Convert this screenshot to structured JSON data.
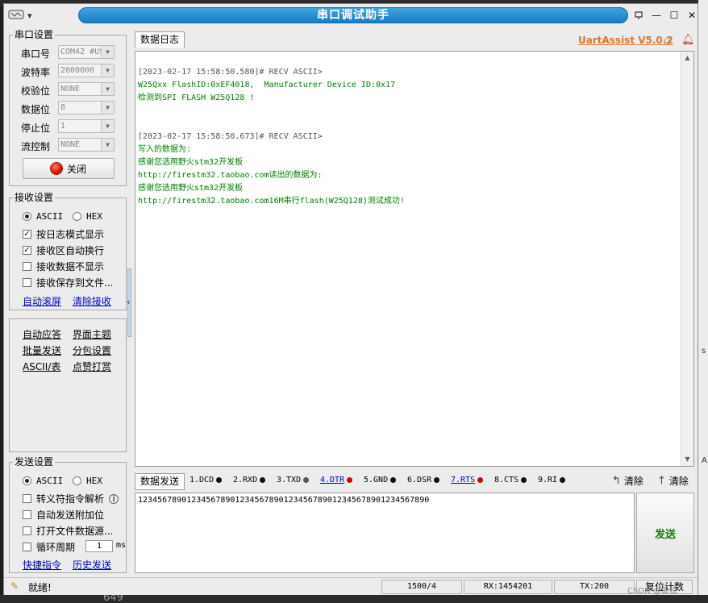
{
  "window": {
    "title": "串口调试助手"
  },
  "serial": {
    "group_title": "串口设置",
    "port_label": "串口号",
    "port_value": "COM42 #US",
    "baud_label": "波特率",
    "baud_value": "2000000",
    "parity_label": "校验位",
    "parity_value": "NONE",
    "databits_label": "数据位",
    "databits_value": "8",
    "stopbits_label": "停止位",
    "stopbits_value": "1",
    "flow_label": "流控制",
    "flow_value": "NONE",
    "close_button": "关闭"
  },
  "receive": {
    "group_title": "接收设置",
    "ascii": "ASCII",
    "hex": "HEX",
    "opt1": "按日志模式显示",
    "opt2": "接收区自动换行",
    "opt3": "接收数据不显示",
    "opt4": "接收保存到文件...",
    "auto_scroll": "自动滚屏",
    "clear_recv": "清除接收"
  },
  "tools": {
    "auto_reply": "自动应答",
    "ui_theme": "界面主题",
    "batch_send": "批量发送",
    "packet_settings": "分包设置",
    "ascii_table": "ASCII/表",
    "tip": "点赞打赏"
  },
  "send": {
    "group_title": "发送设置",
    "ascii": "ASCII",
    "hex": "HEX",
    "opt1": "转义符指令解析",
    "opt2": "自动发送附加位",
    "opt3": "打开文件数据源...",
    "opt4": "循环周期",
    "period_value": "1",
    "period_unit": "ms",
    "shortcuts": "快捷指令",
    "history": "历史发送"
  },
  "log": {
    "tab": "数据日志",
    "lines": [
      {
        "text": "[2023-02-17 15:58:50.580]# RECV ASCII>",
        "kind": "hdr"
      },
      {
        "text": "W25Qxx FlashID:0xEF4018,  Manufacturer Device ID:0x17",
        "kind": "dat"
      },
      {
        "text": "检测到SPI FLASH W25Q128 !",
        "kind": "dat"
      },
      {
        "text": "",
        "kind": "dat"
      },
      {
        "text": "",
        "kind": "dat"
      },
      {
        "text": "[2023-02-17 15:58:50.673]# RECV ASCII>",
        "kind": "hdr"
      },
      {
        "text": "写入的数据为:",
        "kind": "dat"
      },
      {
        "text": "感谢您选用野火stm32开发板",
        "kind": "dat"
      },
      {
        "text": "http://firestm32.taobao.com读出的数据为:",
        "kind": "dat"
      },
      {
        "text": "感谢您选用野火stm32开发板",
        "kind": "dat"
      },
      {
        "text": "http://firestm32.taobao.com16M串行flash(W25Q128)测试成功!",
        "kind": "dat"
      }
    ]
  },
  "brand": {
    "name": "UartAssist V5.0.2"
  },
  "sendbar": {
    "tab": "数据发送",
    "pins": [
      {
        "label": "1.DCD",
        "color": "#111111",
        "link": false
      },
      {
        "label": "2.RXD",
        "color": "#111111",
        "link": false
      },
      {
        "label": "3.TXD",
        "color": "#555555",
        "link": false
      },
      {
        "label": "4.DTR",
        "color": "#d40000",
        "link": true
      },
      {
        "label": "5.GND",
        "color": "#111111",
        "link": false
      },
      {
        "label": "6.DSR",
        "color": "#111111",
        "link": false
      },
      {
        "label": "7.RTS",
        "color": "#d40000",
        "link": true
      },
      {
        "label": "8.CTS",
        "color": "#111111",
        "link": false
      },
      {
        "label": "9.RI",
        "color": "#111111",
        "link": false
      }
    ],
    "clear1": "清除",
    "clear2": "清除"
  },
  "input": {
    "value": "123456789012345678901234567890123456789012345678901234567890"
  },
  "send_button": "发送",
  "status": {
    "ready": "就绪!",
    "counter": "1500/4",
    "rx": "RX:1454201",
    "tx": "TX:200",
    "reset": "复位计数"
  },
  "backdrop": {
    "bottom_number": "649",
    "watermark": "CSDN @鱼弦",
    "edge_s": "s",
    "edge_a": "A"
  }
}
